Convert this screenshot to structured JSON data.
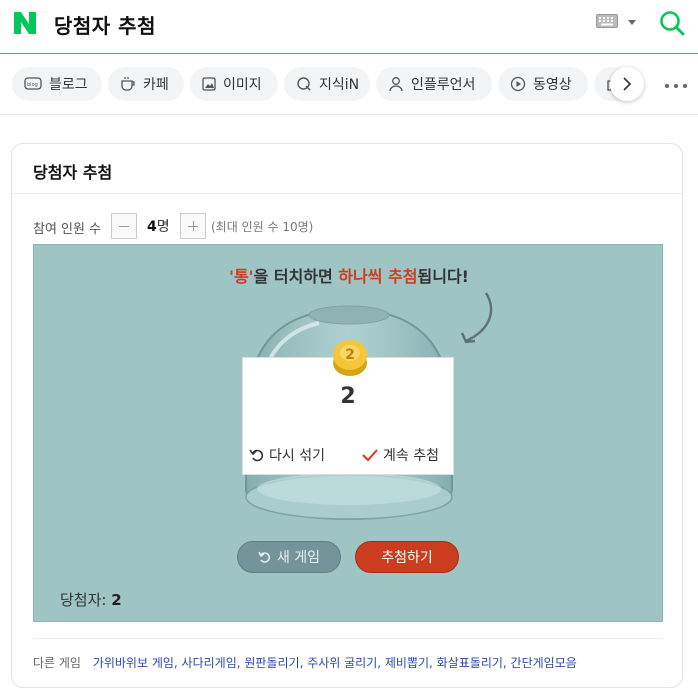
{
  "header": {
    "logo": "N",
    "query": "당첨자 추첨",
    "icons": [
      "naver-logo-icon",
      "keyboard-icon",
      "caret-down-icon",
      "search-icon"
    ],
    "brand_color": "#03c75a"
  },
  "tabs": [
    {
      "label": "블로그",
      "icon": "blog-icon"
    },
    {
      "label": "카페",
      "icon": "cafe-icon"
    },
    {
      "label": "이미지",
      "icon": "image-icon"
    },
    {
      "label": "지식iN",
      "icon": "knowledge-icon"
    },
    {
      "label": "인플루언서",
      "icon": "influencer-icon"
    },
    {
      "label": "동영상",
      "icon": "video-icon"
    },
    {
      "label": "",
      "icon": "shopping-icon"
    }
  ],
  "card": {
    "title": "당첨자 추첨",
    "count": {
      "label": "참여 인원 수",
      "value": "4",
      "unit": "명",
      "max_note": "(최대 인원 수 10명)"
    },
    "game": {
      "instruction_quote_open": "'",
      "instruction_token": "통",
      "instruction_quote_close": "'",
      "instruction_mid": "을 터치하면 ",
      "instruction_red": "하나씩 추첨",
      "instruction_end": "됩니다!",
      "coin_number": "2",
      "popup_value": "2",
      "shuffle_label": "다시 섞기",
      "continue_label": "계속 추첨",
      "new_game_label": "새 게임",
      "draw_label": "추첨하기",
      "winner_label": "당첨자:",
      "winner_value": "2",
      "background_color": "#9ec4c4",
      "accent_red": "#cc3d20"
    },
    "other_games": {
      "label": "다른 게임",
      "links": "가위바위보 게임, 사다리게임, 원판돌리기, 주사위 굴리기, 제비뽑기, 화살표돌리기, 간단게임모음"
    }
  }
}
